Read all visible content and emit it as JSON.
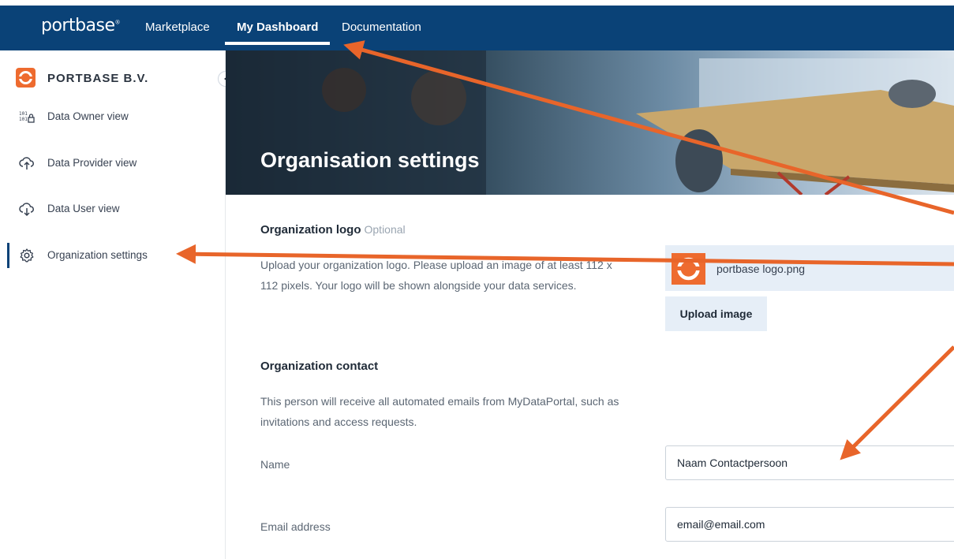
{
  "topbar": {
    "brand": "portbase",
    "brand_mark": "®",
    "nav": [
      {
        "label": "Marketplace"
      },
      {
        "label": "My Dashboard"
      },
      {
        "label": "Documentation"
      }
    ]
  },
  "sidebar": {
    "org_name": "PORTBASE B.V.",
    "items": [
      {
        "label": "Data Owner view",
        "icon": "binary-lock-icon"
      },
      {
        "label": "Data Provider view",
        "icon": "cloud-upload-icon"
      },
      {
        "label": "Data User view",
        "icon": "cloud-download-icon"
      },
      {
        "label": "Organization settings",
        "icon": "gear-icon"
      }
    ]
  },
  "header": {
    "title": "Organisation settings"
  },
  "logo_section": {
    "title": "Organization logo",
    "optional": "Optional",
    "description": "Upload your organization logo. Please upload an image of at least 112 x 112 pixels. Your logo will be shown alongside your data services.",
    "file_name": "portbase logo.png",
    "upload_label": "Upload image"
  },
  "contact_section": {
    "title": "Organization contact",
    "description": "This person will receive all automated emails from MyDataPortal, such as invitations and access requests.",
    "name_label": "Name",
    "name_value": "Naam Contactpersoon",
    "email_label": "Email address",
    "email_value": "email@email.com"
  },
  "colors": {
    "topbar": "#0a4277",
    "accent": "#ee6b2f",
    "annotation_arrow": "#e8652a"
  }
}
